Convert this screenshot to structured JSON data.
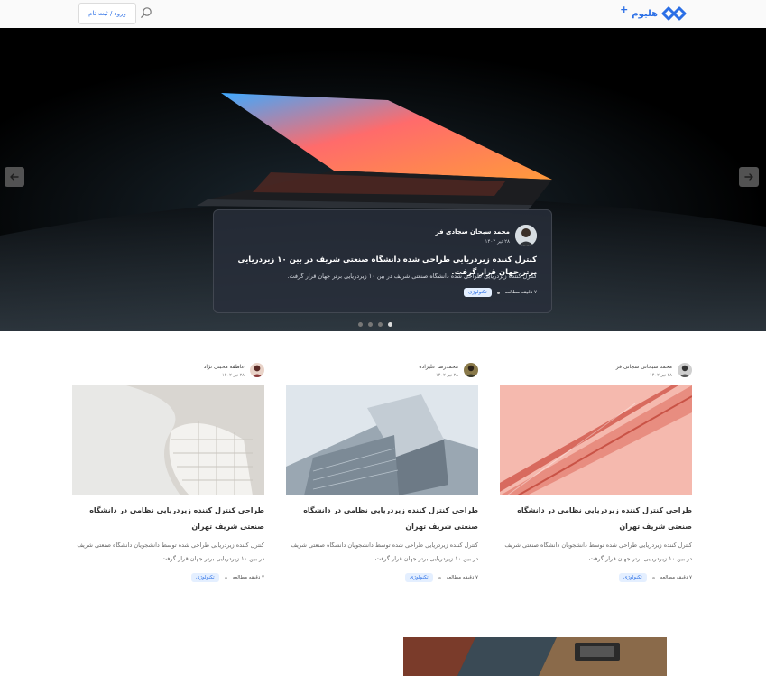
{
  "header": {
    "logo_text": "هلیوم",
    "logo_plus": "+",
    "login_label": "ورود / ثبت نام"
  },
  "hero": {
    "author": "محمد سبحان سجادی فر",
    "date": "۲۸ تیر ۱۴۰۲",
    "title": "کنترل کننده زیردریایی طراحی شده دانشگاه صنعتی شریف در بین ۱۰ زیردریایی برتر جهان قرار گرفت.",
    "excerpt": "کنترل کننده زیردریایی طراحی شده دانشگاه صنعتی شریف در بین ۱۰ زیردریایی برتر جهان قرار گرفت.",
    "read_time": "۷ دقیقه مطالعه",
    "tag": "تکنولوژی",
    "slide_count": 4,
    "active_slide": 4
  },
  "posts": [
    {
      "author": "محمد سبحانی سجانی فر",
      "date": "۲۸ تیر ۱۴۰۲",
      "title": "طراحی کنترل کننده زیردریایی نظامی در دانشگاه صنعتی شریف تهران",
      "excerpt": "کنترل کننده زیردریایی طراحی شده توسط دانشجویان دانشگاه صنعتی شریف در بین ۱۰ زیردریایی برتر جهان قرار گرفت.",
      "read_time": "۷ دقیقه مطالعه",
      "tag": "تکنولوژی"
    },
    {
      "author": "محمدرضا علیزاده",
      "date": "۲۸ تیر ۱۴۰۲",
      "title": "طراحی کنترل کننده زیردریایی نظامی در دانشگاه صنعتی شریف تهران",
      "excerpt": "کنترل کننده زیردریایی طراحی شده توسط دانشجویان دانشگاه صنعتی شریف در بین ۱۰ زیردریایی برتر جهان قرار گرفت.",
      "read_time": "۷ دقیقه مطالعه",
      "tag": "تکنولوژی"
    },
    {
      "author": "عاطفه محبتی نژاد",
      "date": "۲۸ تیر ۱۴۰۲",
      "title": "طراحی کنترل کننده زیردریایی نظامی در دانشگاه صنعتی شریف تهران",
      "excerpt": "کنترل کننده زیردریایی طراحی شده توسط دانشجویان دانشگاه صنعتی شریف در بین ۱۰ زیردریایی برتر جهان قرار گرفت.",
      "read_time": "۷ دقیقه مطالعه",
      "tag": "تکنولوژی"
    }
  ],
  "colors": {
    "accent": "#2b6fe6",
    "tag_bg": "#e4efff"
  }
}
